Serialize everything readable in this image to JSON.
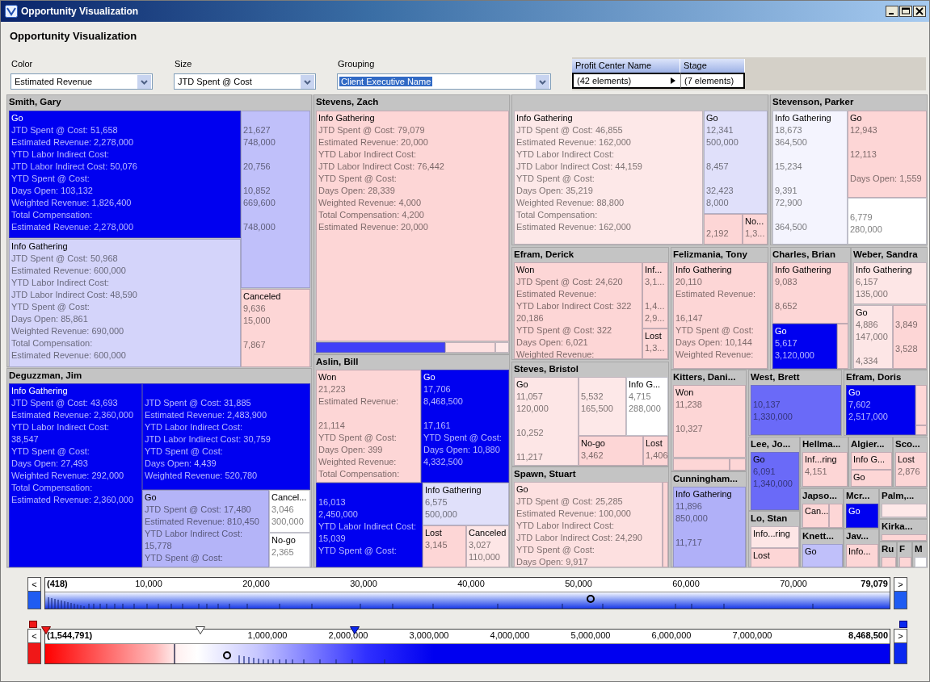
{
  "window": {
    "title": "Opportunity Visualization"
  },
  "heading": "Opportunity Visualization",
  "controls": [
    {
      "label": "Color",
      "value": "Estimated Revenue",
      "selected": false
    },
    {
      "label": "Size",
      "value": "JTD Spent @ Cost",
      "selected": false
    },
    {
      "label": "Grouping",
      "value": "Client Executive Name",
      "selected": true
    }
  ],
  "hierarchy": {
    "columns": [
      {
        "name": "Profit Center Name",
        "count": "(42 elements)"
      },
      {
        "name": "Stage",
        "count": "(7 elements)"
      }
    ]
  },
  "treemap": {
    "groups": [
      {
        "name": "Smith, Gary",
        "tiles": [
          {
            "label": "Go",
            "color": "#0000f0",
            "lines": [
              "JTD Spent @ Cost: 51,658",
              "Estimated Revenue: 2,278,000",
              "YTD Labor Indirect Cost:",
              "JTD Labor Indirect Cost: 50,076",
              "YTD Spent @ Cost:",
              "Days Open: 103,132",
              "Weighted Revenue: 1,826,400",
              "Total Compensation:",
              "Estimated Revenue: 2,278,000"
            ]
          },
          {
            "label": "Info Gathering",
            "color": "#d4d4fa",
            "lines": [
              "JTD Spent @ Cost: 50,968",
              "Estimated Revenue: 600,000",
              "YTD Labor Indirect Cost:",
              "JTD Labor Indirect Cost: 48,590",
              "YTD Spent @ Cost:",
              "Days Open: 85,861",
              "Weighted Revenue: 690,000",
              "Total Compensation:",
              "Estimated Revenue: 600,000"
            ]
          },
          {
            "color": "#c0c0fa",
            "lines": [
              {
                "text": "21,627",
                "gap": true
              },
              "748,000",
              {
                "text": "20,756",
                "gap": true
              },
              {
                "text": "10,852",
                "gap": true
              },
              "669,600",
              {
                "text": "748,000",
                "gap": true
              }
            ]
          },
          {
            "label": "Canceled",
            "color": "#fdd6d6",
            "lines": [
              "9,636",
              "15,000",
              {
                "text": "7,867",
                "gap": true
              }
            ]
          }
        ]
      },
      {
        "name": "Stevens, Zach",
        "tiles": [
          {
            "label": "Info Gathering",
            "color": "#fdd6d6",
            "lines": [
              "JTD Spent @ Cost: 79,079",
              "Estimated Revenue: 20,000",
              "YTD Labor Indirect Cost:",
              "JTD Labor Indirect Cost: 76,442",
              "YTD Spent @ Cost:",
              "Days Open: 28,339",
              "Weighted Revenue: 4,000",
              "Total Compensation: 4,200",
              "Estimated Revenue: 20,000"
            ]
          },
          {
            "color": "#4040f8"
          },
          {
            "color": "#fde0e0"
          },
          {
            "color": "#fde8e8"
          }
        ]
      },
      {
        "tiles": [
          {
            "label": "Info Gathering",
            "color": "#fde8e8",
            "lines": [
              "JTD Spent @ Cost: 46,855",
              "Estimated Revenue: 162,000",
              "YTD Labor Indirect Cost:",
              "JTD Labor Indirect Cost: 44,159",
              "YTD Spent @ Cost:",
              "Days Open: 35,219",
              "Weighted Revenue: 88,800",
              "Total Compensation:",
              "Estimated Revenue: 162,000"
            ]
          },
          {
            "label": "Go",
            "color": "#e0e0fa",
            "lines": [
              "12,341",
              "500,000",
              {
                "text": "8,457",
                "gap": true
              },
              {
                "text": "32,423",
                "gap": true
              },
              "8,000"
            ]
          },
          {
            "color": "#fdd6d6",
            "lines": [
              {
                "text": "2,192",
                "gap": true
              }
            ]
          },
          {
            "label": "No...",
            "color": "#fdd6d6",
            "lines": [
              "1,3..."
            ]
          }
        ]
      },
      {
        "name": "Stevenson, Parker",
        "tiles": [
          {
            "label": "Info Gathering",
            "color": "#f4f4fe",
            "lines": [
              "18,673",
              "364,500",
              {
                "text": "15,234",
                "gap": true
              },
              {
                "text": "9,391",
                "gap": true
              },
              "72,900",
              {
                "text": "364,500",
                "gap": true
              }
            ]
          },
          {
            "label": "Go",
            "color": "#fdd6d6",
            "lines": [
              "12,943",
              {
                "text": "12,113",
                "gap": true
              },
              {
                "text": "Days Open: 1,559",
                "gap": true
              }
            ]
          },
          {
            "color": "#ffffff",
            "lines": [
              {
                "text": "6,779",
                "gap": true
              },
              "280,000"
            ]
          }
        ]
      },
      {
        "name": "Efram, Derick",
        "tiles": [
          {
            "label": "Won",
            "color": "#fdd6d6",
            "lines": [
              "JTD Spent @ Cost: 24,620",
              "Estimated Revenue:",
              "YTD Labor Indirect Cost: 322",
              "20,186",
              "YTD Spent @ Cost: 322",
              "Days Open: 6,021",
              "Weighted Revenue:"
            ]
          },
          {
            "label": "Inf...",
            "color": "#fdd6d6",
            "lines": [
              "3,1...",
              {
                "text": "1,4...",
                "gap": true
              },
              "2,9..."
            ]
          },
          {
            "label": "Lost",
            "color": "#fdd6d6",
            "lines": [
              "1,3..."
            ]
          }
        ]
      },
      {
        "name": "Felizmania, Tony",
        "tiles": [
          {
            "label": "Info Gathering",
            "color": "#fdd6d6",
            "lines": [
              "20,110",
              "Estimated Revenue:",
              {
                "text": "16,147",
                "gap": true
              },
              "YTD Spent @ Cost:",
              "Days Open: 10,144",
              "Weighted Revenue:"
            ]
          }
        ]
      },
      {
        "name": "Charles, Brian",
        "tiles": [
          {
            "label": "Info Gathering",
            "color": "#fdd6d6",
            "lines": [
              "9,083",
              {
                "text": "8,652",
                "gap": true
              }
            ]
          },
          {
            "label": "Go",
            "color": "#0000f0",
            "lines": [
              "5,617",
              "3,120,000"
            ]
          },
          {
            "color": "#fdd6d6"
          }
        ]
      },
      {
        "name": "Weber, Sandra",
        "tiles": [
          {
            "label": "Info Gathering",
            "color": "#fde6e6",
            "lines": [
              "6,157",
              "135,000"
            ]
          },
          {
            "label": "Go",
            "color": "#fde6e6",
            "lines": [
              "4,886",
              "147,000",
              {
                "text": "4,334",
                "gap": true
              }
            ]
          },
          {
            "color": "#fdd6d6",
            "lines": [
              {
                "text": "3,849",
                "gap": true
              },
              {
                "text": "3,528",
                "gap": true
              }
            ]
          }
        ]
      },
      {
        "name": "Aslin, Bill",
        "tiles": [
          {
            "label": "Won",
            "color": "#fdd6d6",
            "lines": [
              "21,223",
              "Estimated Revenue:",
              {
                "text": "21,114",
                "gap": true
              },
              "YTD Spent @ Cost:",
              "Days Open: 399",
              "Weighted Revenue:",
              "Total Compensation:"
            ]
          },
          {
            "label": "Go",
            "color": "#0000f0",
            "lines": [
              "17,706",
              "8,468,500",
              {
                "text": "17,161",
                "gap": true
              },
              "YTD Spent @ Cost:",
              "Days Open: 10,880",
              "4,332,500"
            ]
          },
          {
            "color": "#0000f0",
            "lines": [
              {
                "text": "16,013",
                "gap": true
              },
              "2,450,000",
              "YTD Labor Indirect Cost:",
              "15,039",
              "YTD Spent @ Cost:"
            ]
          },
          {
            "label": "Info Gathering",
            "color": "#e0e0fa",
            "lines": [
              "6,575",
              "500,000"
            ]
          },
          {
            "label": "Lost",
            "color": "#fdd6d6",
            "lines": [
              "3,145"
            ]
          },
          {
            "label": "Canceled",
            "color": "#fde6e6",
            "lines": [
              "3,027",
              "110,000"
            ]
          }
        ]
      },
      {
        "name": "Steves, Bristol",
        "tiles": [
          {
            "label": "Go",
            "color": "#fde6e6",
            "lines": [
              "11,057",
              "120,000",
              {
                "text": "10,252",
                "gap": true
              },
              {
                "text": "11,217",
                "gap": true
              }
            ]
          },
          {
            "color": "#fde8e8",
            "lines": [
              {
                "text": "5,532",
                "gap": true
              },
              "165,500"
            ]
          },
          {
            "label": "Info G...",
            "color": "#ffffff",
            "lines": [
              "4,715",
              "288,000"
            ]
          },
          {
            "label": "No-go",
            "color": "#fdd6d6",
            "lines": [
              "3,462"
            ]
          },
          {
            "label": "Lost",
            "color": "#fdd6d6",
            "lines": [
              "1,406"
            ]
          }
        ]
      },
      {
        "name": "Kitters, Dani...",
        "tiles": [
          {
            "label": "Won",
            "color": "#fdd6d6",
            "lines": [
              "11,238",
              {
                "text": "10,327",
                "gap": true
              }
            ]
          },
          {
            "color": "#fdd6d6"
          },
          {
            "color": "#fdd6d6"
          }
        ]
      },
      {
        "name": "West, Brett",
        "tiles": [
          {
            "color": "#6a6af8",
            "lines": [
              {
                "text": "10,137",
                "gap": true
              },
              "1,330,000"
            ]
          }
        ]
      },
      {
        "name": "Efram, Doris",
        "tiles": [
          {
            "label": "Go",
            "color": "#0000f0",
            "lines": [
              "7,602",
              "2,517,000"
            ]
          },
          {
            "color": "#fdd6d6"
          },
          {
            "color": "#fdd6d6"
          }
        ]
      },
      {
        "name": "Lee, Jo...",
        "tiles": [
          {
            "label": "Go",
            "color": "#6a6af8",
            "lines": [
              "6,091",
              "1,340,000"
            ]
          }
        ]
      },
      {
        "name": "Hellma...",
        "tiles": [
          {
            "label": "Inf...ring",
            "color": "#fdd6d6",
            "lines": [
              "4,151"
            ]
          }
        ]
      },
      {
        "name": "Algier...",
        "tiles": [
          {
            "label": "Info G...",
            "color": "#fdd6d6"
          },
          {
            "label": "Go",
            "color": "#fdd6d6"
          }
        ]
      },
      {
        "name": "Sco...",
        "tiles": [
          {
            "label": "Lost",
            "color": "#fdd6d6",
            "lines": [
              "2,876"
            ]
          }
        ]
      },
      {
        "name": "Deguzzman, Jim",
        "tiles": [
          {
            "label": "Info Gathering",
            "color": "#0000f0",
            "lines": [
              "JTD Spent @ Cost: 43,693",
              "Estimated Revenue: 2,360,000",
              "YTD Labor Indirect Cost:",
              "38,547",
              "YTD Spent @ Cost:",
              "Days Open: 27,493",
              "Weighted Revenue: 292,000",
              "Total Compensation:",
              "Estimated Revenue: 2,360,000"
            ]
          },
          {
            "color": "#0000f0",
            "lines": [
              {
                "text": "JTD Spent @ Cost: 31,885",
                "gap": true
              },
              "Estimated Revenue: 2,483,900",
              "YTD Labor Indirect Cost:",
              "JTD Labor Indirect Cost: 30,759",
              "YTD Spent @ Cost:",
              "Days Open: 4,439",
              "Weighted Revenue: 520,780"
            ]
          },
          {
            "label": "Go",
            "color": "#b4b4f8",
            "lines": [
              "JTD Spent @ Cost: 17,480",
              "Estimated Revenue: 810,450",
              "YTD Labor Indirect Cost:",
              "15,778",
              "YTD Spent @ Cost:"
            ]
          },
          {
            "label": "Cancel...",
            "color": "#ffffff",
            "lines": [
              "3,046",
              "300,000"
            ]
          },
          {
            "label": "No-go",
            "color": "#ffffff",
            "lines": [
              "2,365"
            ]
          }
        ]
      },
      {
        "name": "Spawn, Stuart",
        "tiles": [
          {
            "label": "Go",
            "color": "#fde0e0",
            "lines": [
              "JTD Spent @ Cost: 25,285",
              "Estimated Revenue: 100,000",
              "YTD Labor Indirect Cost:",
              "JTD Labor Indirect Cost: 24,290",
              "YTD Spent @ Cost:",
              "Days Open: 9,917"
            ]
          },
          {
            "color": "#fdd6d6"
          }
        ]
      },
      {
        "name": "Cunningham...",
        "tiles": [
          {
            "label": "Info Gathering",
            "color": "#b0b0f8",
            "lines": [
              "11,896",
              "850,000",
              {
                "text": "11,717",
                "gap": true
              }
            ]
          }
        ]
      },
      {
        "name": "Japso...",
        "tiles": [
          {
            "label": "Can...",
            "color": "#fdd6d6"
          },
          {
            "color": "#fdd6d6"
          }
        ]
      },
      {
        "name": "Mcr...",
        "tiles": [
          {
            "label": "Go",
            "color": "#0000f0"
          }
        ]
      },
      {
        "name": "Palm,...",
        "tiles": [
          {
            "color": "#fde8e8"
          }
        ]
      },
      {
        "name": "Kirka...",
        "tiles": [
          {
            "color": "#fdd6d6"
          }
        ]
      },
      {
        "name": "Lo, Stan",
        "tiles": [
          {
            "label": "Info...ring",
            "color": "#fde6e6"
          },
          {
            "label": "Lost",
            "color": "#fdd6d6"
          }
        ]
      },
      {
        "name": "Knett...",
        "tiles": [
          {
            "label": "Go",
            "color": "#c0c0fa"
          }
        ]
      },
      {
        "name": "Jav...",
        "tiles": [
          {
            "label": "Info...",
            "color": "#fdd6d6"
          }
        ]
      },
      {
        "name": "Ru",
        "tiles": [
          {
            "color": "#fdd6d6"
          }
        ]
      },
      {
        "name": "F",
        "tiles": [
          {
            "color": "#fdd6d6"
          }
        ]
      },
      {
        "name": "M",
        "tiles": [
          {
            "color": "#ffffff"
          }
        ]
      }
    ]
  },
  "range_sliders": [
    {
      "kind": "size",
      "prev": "<",
      "next": ">",
      "min_label": "(418)",
      "max_label": "79,079",
      "ticks": [
        "10,000",
        "20,000",
        "30,000",
        "40,000",
        "50,000",
        "60,000",
        "70,000"
      ]
    },
    {
      "kind": "color",
      "prev": "<",
      "next": ">",
      "min_label": "(1,544,791)",
      "max_label": "8,468,500",
      "ticks": [
        "1,000,000",
        "2,000,000",
        "3,000,000",
        "4,000,000",
        "5,000,000",
        "6,000,000",
        "7,000,000"
      ]
    }
  ]
}
